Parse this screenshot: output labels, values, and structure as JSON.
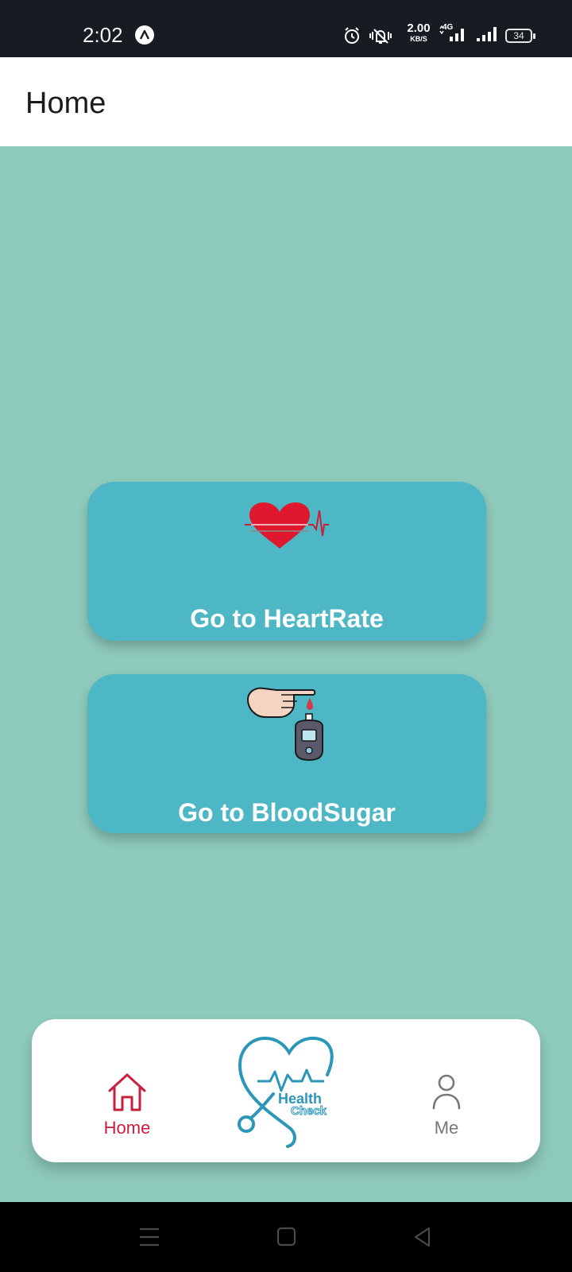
{
  "status_bar": {
    "time": "2:02",
    "network_speed_value": "2.00",
    "network_speed_unit": "KB/S",
    "network_type": "4G",
    "battery_level": "34",
    "icons": [
      "app-notification-icon",
      "alarm-icon",
      "vibrate-silent-icon",
      "signal-4g-icon",
      "signal-icon",
      "battery-icon"
    ]
  },
  "app_bar": {
    "title": "Home"
  },
  "cards": [
    {
      "label": "Go to HeartRate",
      "icon": "heart-rate-icon"
    },
    {
      "label": "Go to BloodSugar",
      "icon": "glucose-meter-icon"
    }
  ],
  "bottom_nav": {
    "home_label": "Home",
    "logo_text_1": "Health",
    "logo_text_2": "Check",
    "me_label": "Me"
  },
  "colors": {
    "background": "#8fcbbd",
    "card": "#4db7c6",
    "active_tab": "#c8203c",
    "inactive_tab": "#777777",
    "logo": "#2a96b8",
    "heart": "#e0182d"
  },
  "system_nav": {
    "icons": [
      "menu-icon",
      "square-home-icon",
      "back-triangle-icon"
    ]
  }
}
